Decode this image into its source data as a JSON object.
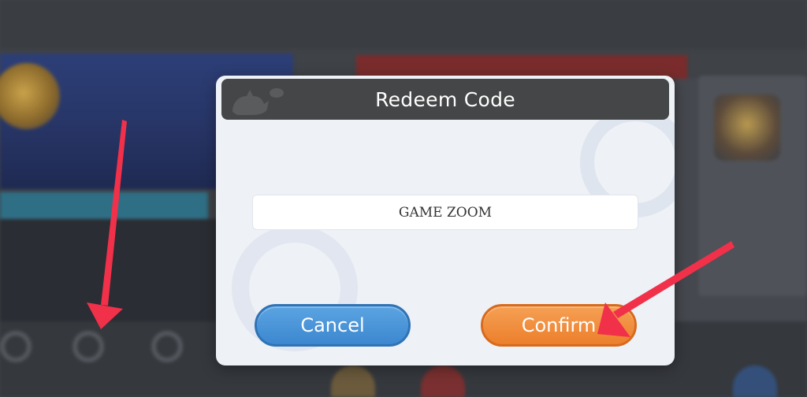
{
  "dialog": {
    "title": "Redeem Code",
    "code_value": "GAME ZOOM",
    "cancel_label": "Cancel",
    "confirm_label": "Confirm"
  },
  "colors": {
    "dialog_bg": "#eef1f6",
    "header_bg": "#454647",
    "cancel_button": "#3c87cf",
    "confirm_button": "#ec7f2c",
    "annotation_arrow": "#f1304a"
  },
  "icons": {
    "header_decoration": "cat-silhouette-icon",
    "annotations": [
      "arrow-down-annotation",
      "arrow-to-confirm-annotation"
    ]
  }
}
